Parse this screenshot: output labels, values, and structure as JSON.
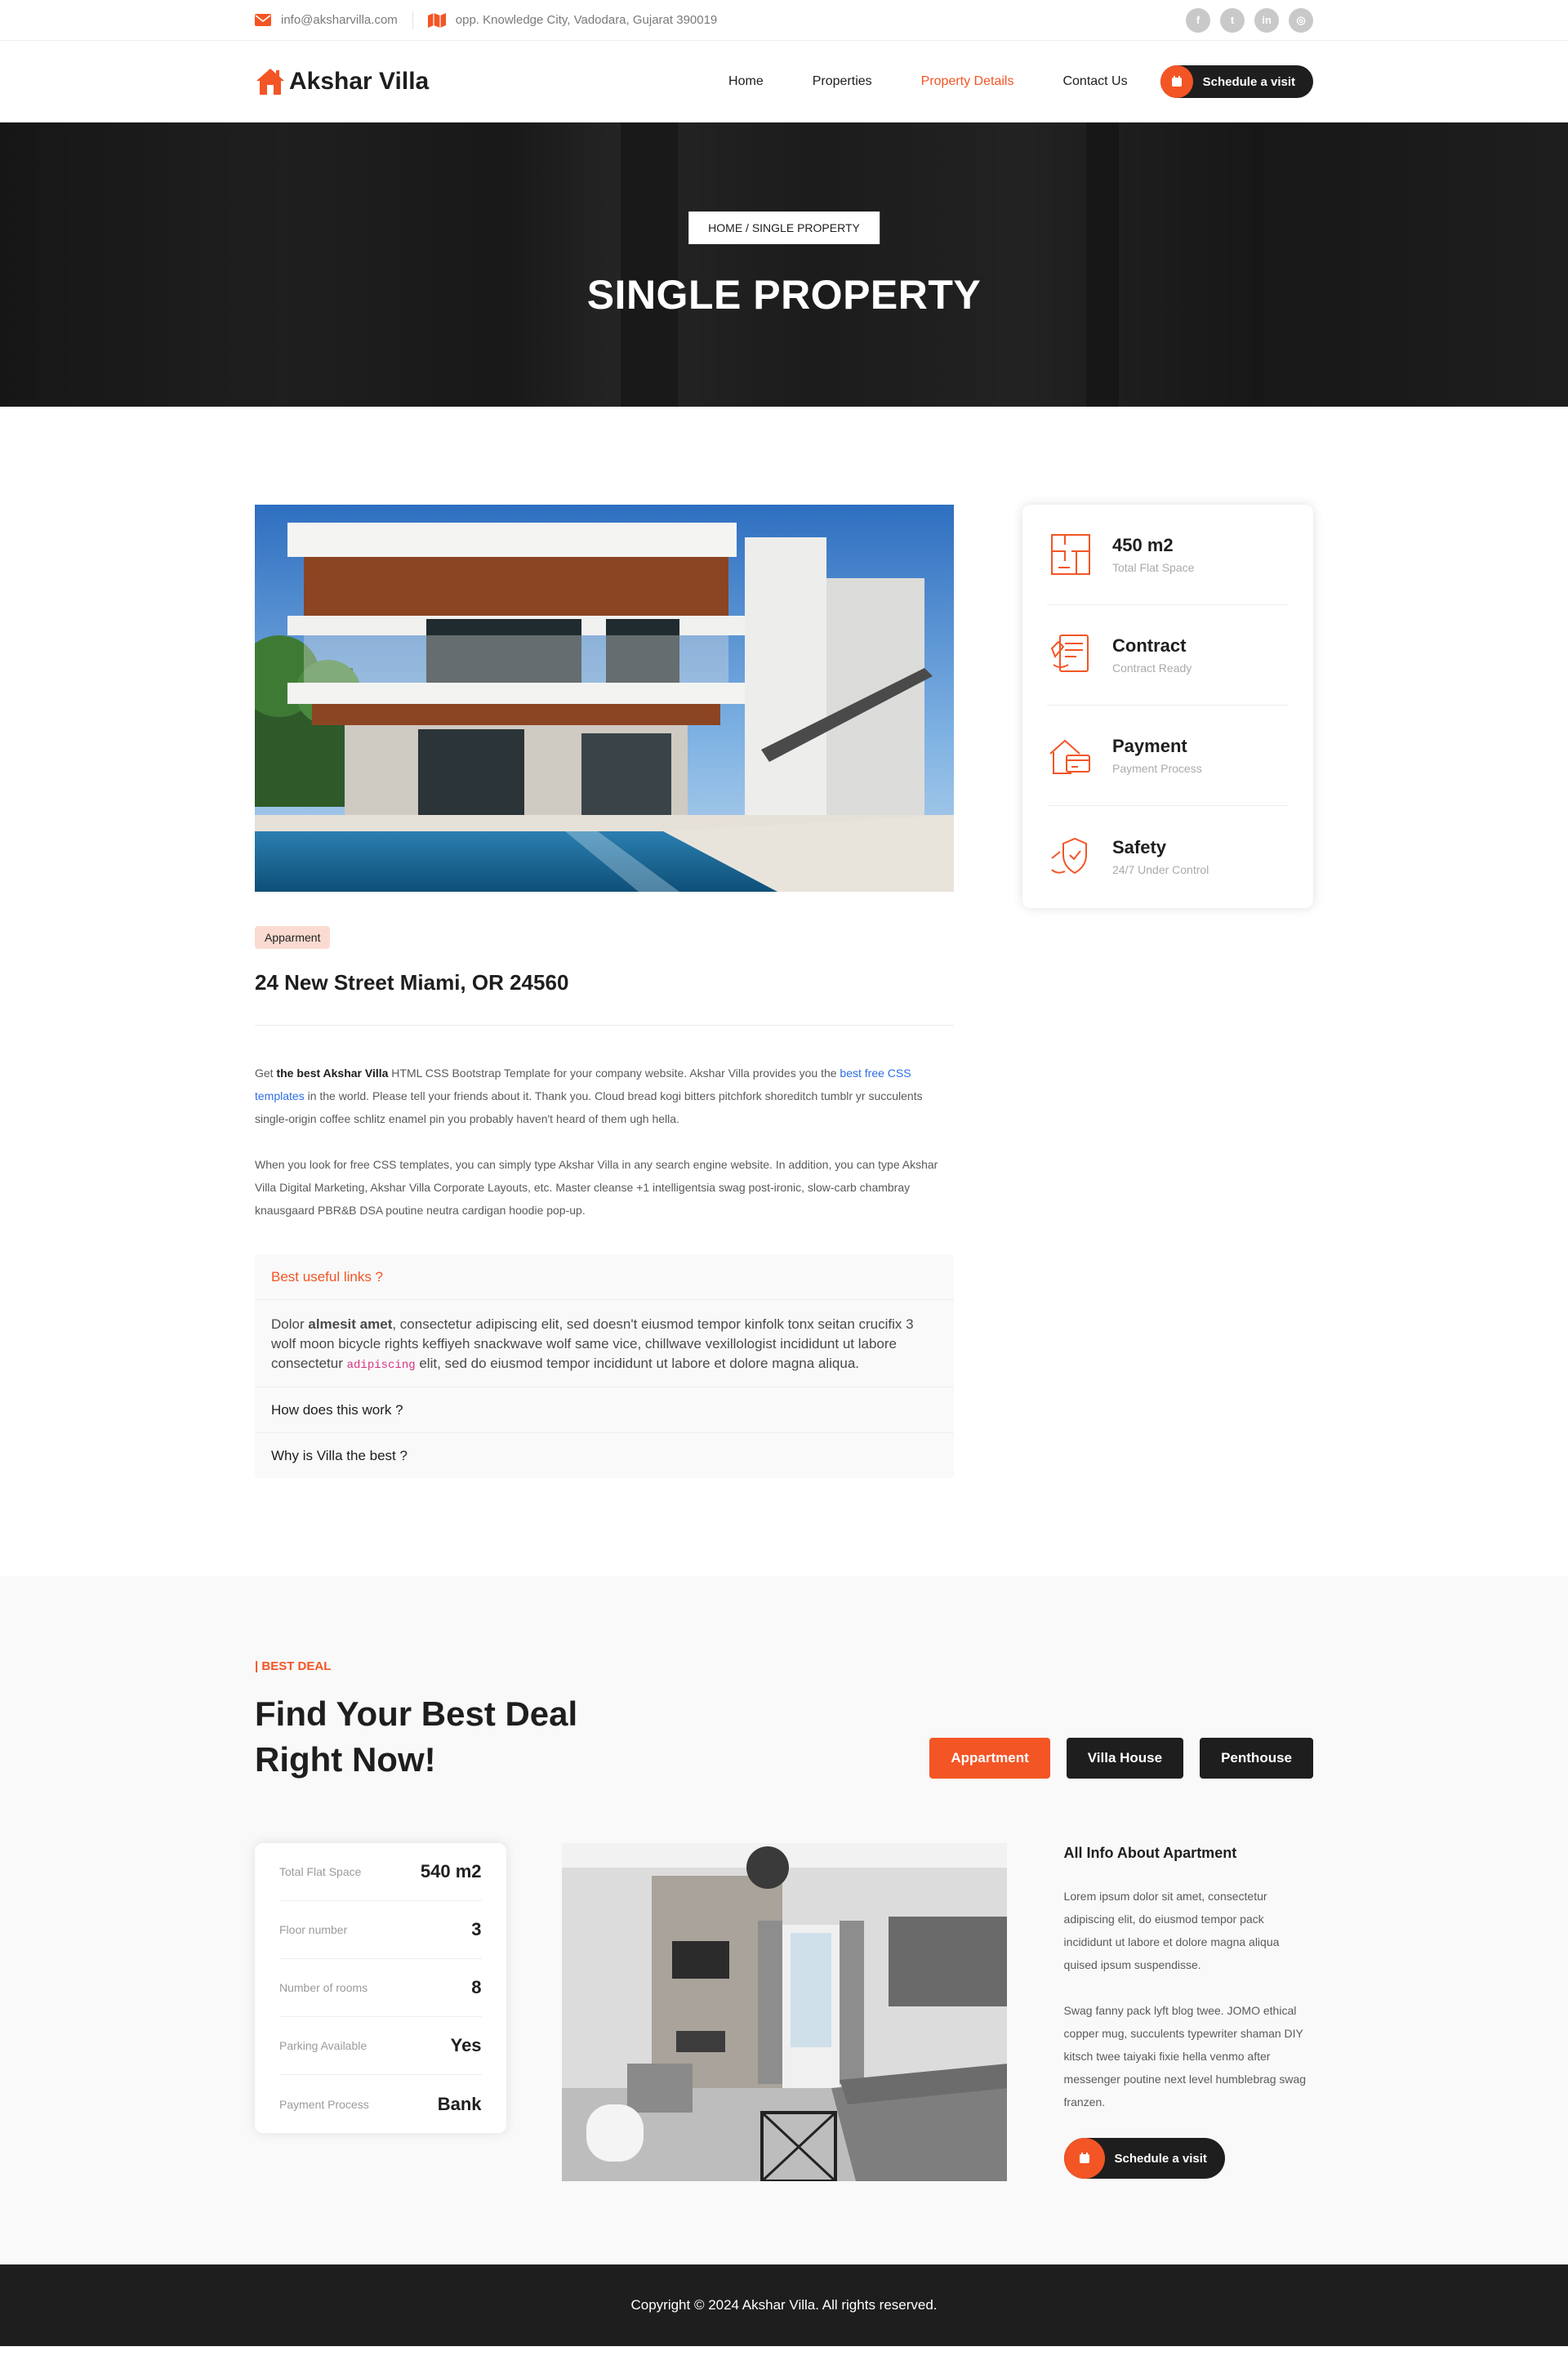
{
  "topbar": {
    "email": "info@aksharvilla.com",
    "address": "opp. Knowledge City, Vadodara, Gujarat 390019",
    "socials": [
      "facebook-icon",
      "twitter-icon",
      "linkedin-icon",
      "instagram-icon"
    ]
  },
  "header": {
    "logo_text": "Akshar Villa",
    "nav": [
      {
        "label": "Home",
        "active": false
      },
      {
        "label": "Properties",
        "active": false
      },
      {
        "label": "Property Details",
        "active": true
      },
      {
        "label": "Contact Us",
        "active": false
      }
    ],
    "cta_label": "Schedule a visit"
  },
  "hero": {
    "breadcrumb": "HOME / SINGLE PROPERTY",
    "title": "SINGLE PROPERTY"
  },
  "property": {
    "tag": "Apparment",
    "address": "24 New Street Miami, OR 24560",
    "para1": {
      "pre": "Get ",
      "bold": "the best Akshar Villa",
      "mid": " HTML CSS Bootstrap Template for your company website. Akshar Villa provides you the ",
      "link": "best free CSS templates",
      "post": " in the world. Please tell your friends about it. Thank you. Cloud bread kogi bitters pitchfork shoreditch tumblr yr succulents single-origin coffee schlitz enamel pin you probably haven't heard of them ugh hella."
    },
    "para2": "When you look for free CSS templates, you can simply type Akshar Villa in any search engine website. In addition, you can type Akshar Villa Digital Marketing, Akshar Villa Corporate Layouts, etc. Master cleanse +1 intelligentsia swag post-ironic, slow-carb chambray knausgaard PBR&B DSA poutine neutra cardigan hoodie pop-up.",
    "accordion": [
      {
        "title": "Best useful links ?",
        "open": true
      },
      {
        "title": "How does this work ?",
        "open": false
      },
      {
        "title": "Why is Villa the best ?",
        "open": false
      }
    ],
    "accordion_body": {
      "pre": "Dolor ",
      "bold": "almesit amet",
      "mid": ", consectetur adipiscing elit, sed doesn't eiusmod tempor kinfolk tonx seitan crucifix 3 wolf moon bicycle rights keffiyeh snackwave wolf same vice, chillwave vexillologist incididunt ut labore consectetur ",
      "code": "adipiscing",
      "post": " elit, sed do eiusmod tempor incididunt ut labore et dolore magna aliqua."
    }
  },
  "info_card": [
    {
      "icon": "floor-plan-icon",
      "title": "450 m2",
      "sub": "Total Flat Space"
    },
    {
      "icon": "contract-icon",
      "title": "Contract",
      "sub": "Contract Ready"
    },
    {
      "icon": "payment-icon",
      "title": "Payment",
      "sub": "Payment Process"
    },
    {
      "icon": "safety-icon",
      "title": "Safety",
      "sub": "24/7 Under Control"
    }
  ],
  "deal": {
    "kicker": "| Best Deal",
    "title_line1": "Find Your Best Deal",
    "title_line2": "Right Now!",
    "tabs": [
      {
        "label": "Appartment",
        "active": true
      },
      {
        "label": "Villa House",
        "active": false
      },
      {
        "label": "Penthouse",
        "active": false
      }
    ],
    "stats": [
      {
        "label": "Total Flat Space",
        "value": "540 m2"
      },
      {
        "label": "Floor number",
        "value": "3"
      },
      {
        "label": "Number of rooms",
        "value": "8"
      },
      {
        "label": "Parking Available",
        "value": "Yes"
      },
      {
        "label": "Payment Process",
        "value": "Bank"
      }
    ],
    "info_title": "All Info About Apartment",
    "info_p1": "Lorem ipsum dolor sit amet, consectetur adipiscing elit, do eiusmod tempor pack incididunt ut labore et dolore magna aliqua quised ipsum suspendisse.",
    "info_p2": "Swag fanny pack lyft blog twee. JOMO ethical copper mug, succulents typewriter shaman DIY kitsch twee taiyaki fixie hella venmo after messenger poutine next level humblebrag swag franzen.",
    "cta_label": "Schedule a visit"
  },
  "footer": {
    "copyright": "Copyright © 2024 Akshar Villa. All rights reserved."
  },
  "colors": {
    "accent": "#f35525",
    "dark": "#1e1e1e",
    "light_bg": "#f9f9f9",
    "link": "#2e6ee6"
  }
}
